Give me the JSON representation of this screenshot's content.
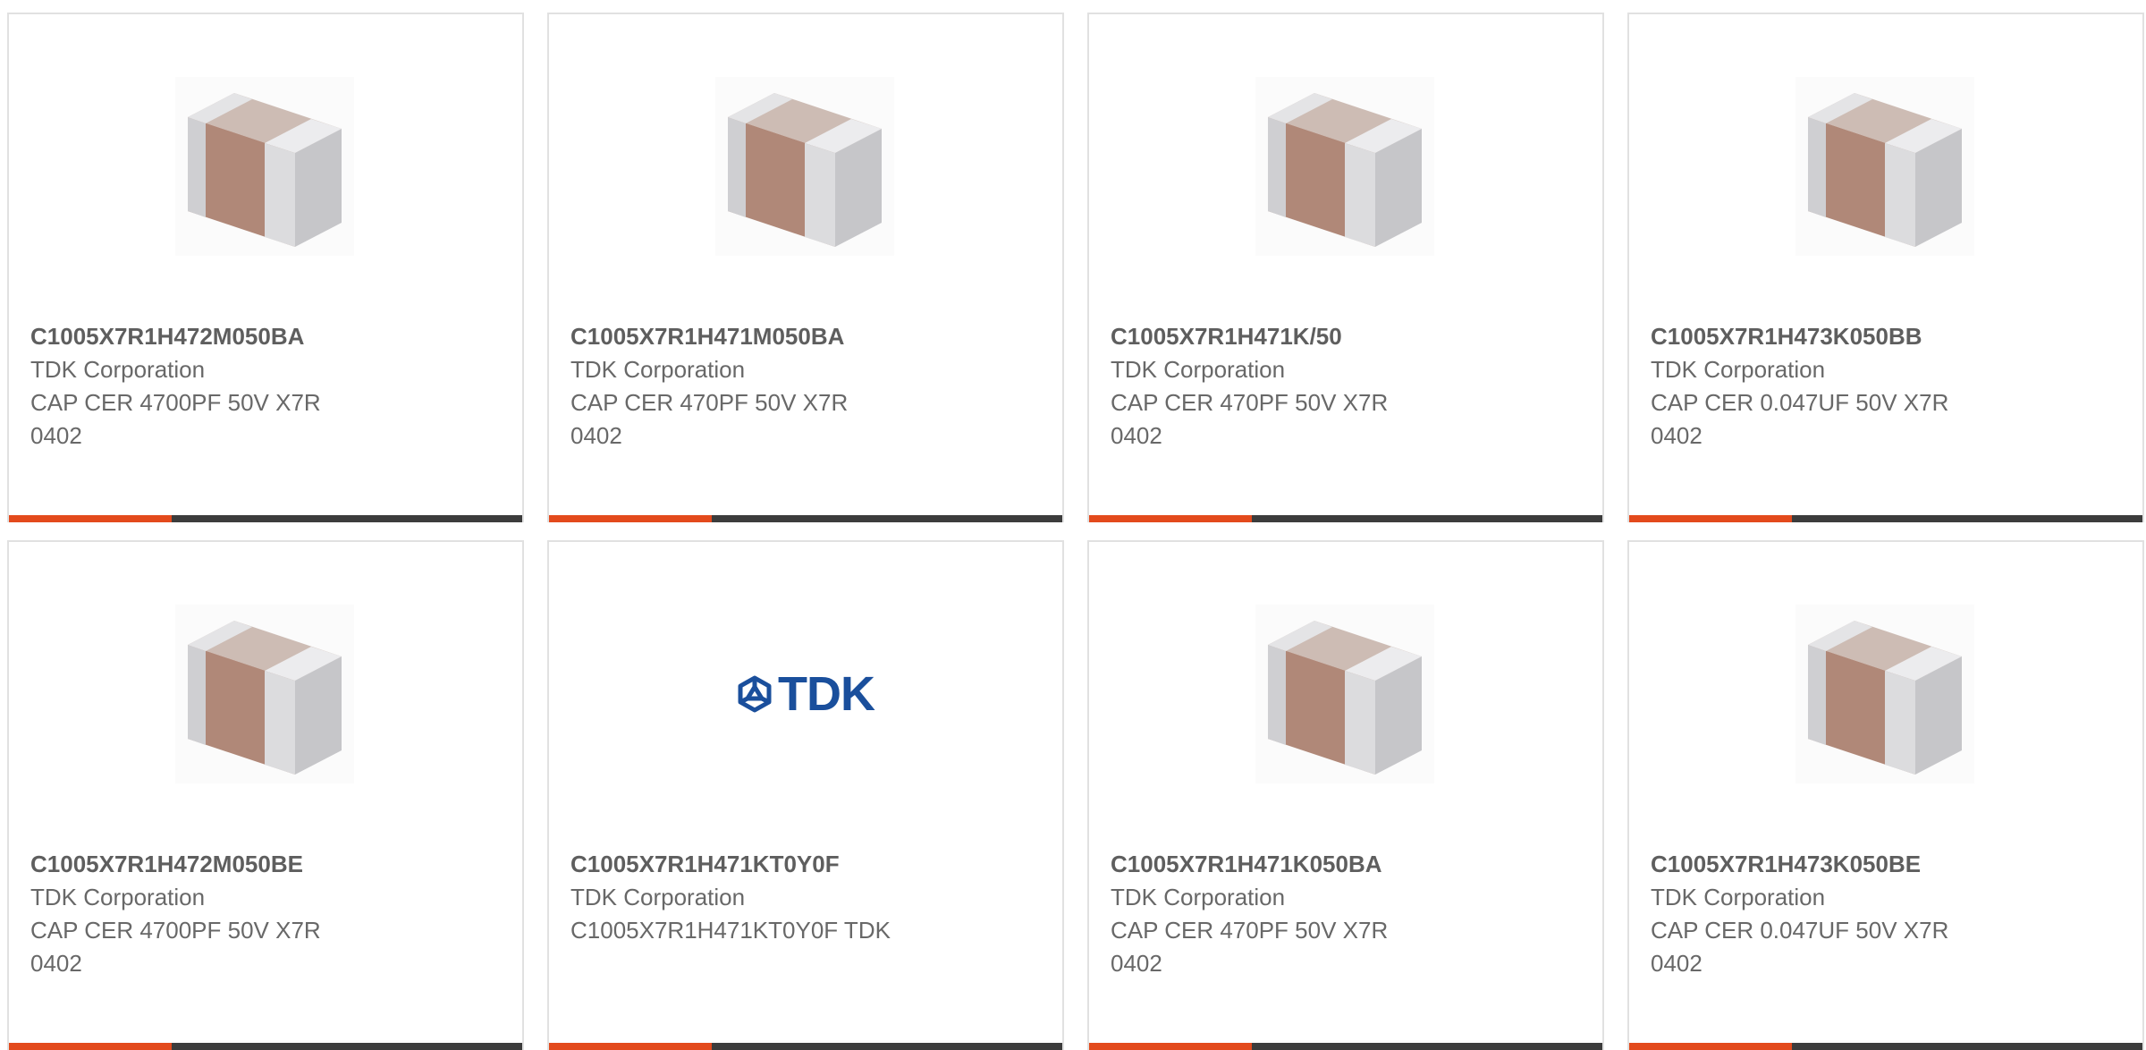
{
  "products": [
    {
      "part_number": "C1005X7R1H472M050BA",
      "manufacturer": "TDK Corporation",
      "description": "CAP CER 4700PF 50V X7R 0402",
      "image": "ceramic-capacitor-image"
    },
    {
      "part_number": "C1005X7R1H471M050BA",
      "manufacturer": "TDK Corporation",
      "description": "CAP CER 470PF 50V X7R 0402",
      "image": "ceramic-capacitor-image"
    },
    {
      "part_number": "C1005X7R1H471K/50",
      "manufacturer": "TDK Corporation",
      "description": "CAP CER 470PF 50V X7R 0402",
      "image": "ceramic-capacitor-image"
    },
    {
      "part_number": "C1005X7R1H473K050BB",
      "manufacturer": "TDK Corporation",
      "description": "CAP CER 0.047UF 50V X7R 0402",
      "image": "ceramic-capacitor-image"
    },
    {
      "part_number": "C1005X7R1H472M050BE",
      "manufacturer": "TDK Corporation",
      "description": "CAP CER 4700PF 50V X7R 0402",
      "image": "ceramic-capacitor-image"
    },
    {
      "part_number": "C1005X7R1H471KT0Y0F",
      "manufacturer": "TDK Corporation",
      "description": "C1005X7R1H471KT0Y0F TDK",
      "image": "tdk-logo-image",
      "logo_text": "TDK"
    },
    {
      "part_number": "C1005X7R1H471K050BA",
      "manufacturer": "TDK Corporation",
      "description": "CAP CER 470PF 50V X7R 0402",
      "image": "ceramic-capacitor-image"
    },
    {
      "part_number": "C1005X7R1H473K050BE",
      "manufacturer": "TDK Corporation",
      "description": "CAP CER 0.047UF 50V X7R 0402",
      "image": "ceramic-capacitor-image"
    }
  ],
  "colors": {
    "accent_bar": "#e34a1c",
    "bar": "#3c3c3c",
    "tdk_blue": "#1a4f9c",
    "card_border": "#e1e1e1",
    "text": "#686868"
  }
}
